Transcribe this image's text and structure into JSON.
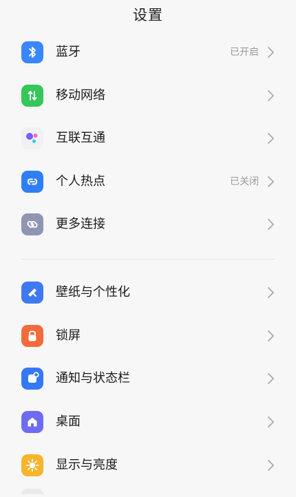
{
  "header": {
    "title": "设置"
  },
  "colors": {
    "bluetooth": "#3a86ff",
    "mobile_network": "#34c759",
    "hotspot": "#2f7ef6",
    "more_connections": "#8e96b3",
    "wallpaper": "#3f79f1",
    "lock": "#f26b3a",
    "notification": "#3478f6",
    "desktop": "#6f6cf3",
    "display": "#f7b52b",
    "divider": "#e2e2e2"
  },
  "settings": {
    "bluetooth": {
      "label": "蓝牙",
      "status": "已开启",
      "icon": "bluetooth-icon"
    },
    "mobile_network": {
      "label": "移动网络",
      "icon": "mobile-data-icon"
    },
    "interconnect": {
      "label": "互联互通",
      "icon": "dots-icon"
    },
    "hotspot": {
      "label": "个人热点",
      "status": "已关闭",
      "icon": "hotspot-link-icon"
    },
    "more_connections": {
      "label": "更多连接",
      "icon": "link-icon"
    },
    "wallpaper": {
      "label": "壁纸与个性化",
      "icon": "brush-icon"
    },
    "lock_screen": {
      "label": "锁屏",
      "icon": "lock-icon"
    },
    "notification": {
      "label": "通知与状态栏",
      "icon": "notification-icon"
    },
    "desktop": {
      "label": "桌面",
      "icon": "home-icon"
    },
    "display": {
      "label": "显示与亮度",
      "icon": "sun-icon"
    }
  }
}
